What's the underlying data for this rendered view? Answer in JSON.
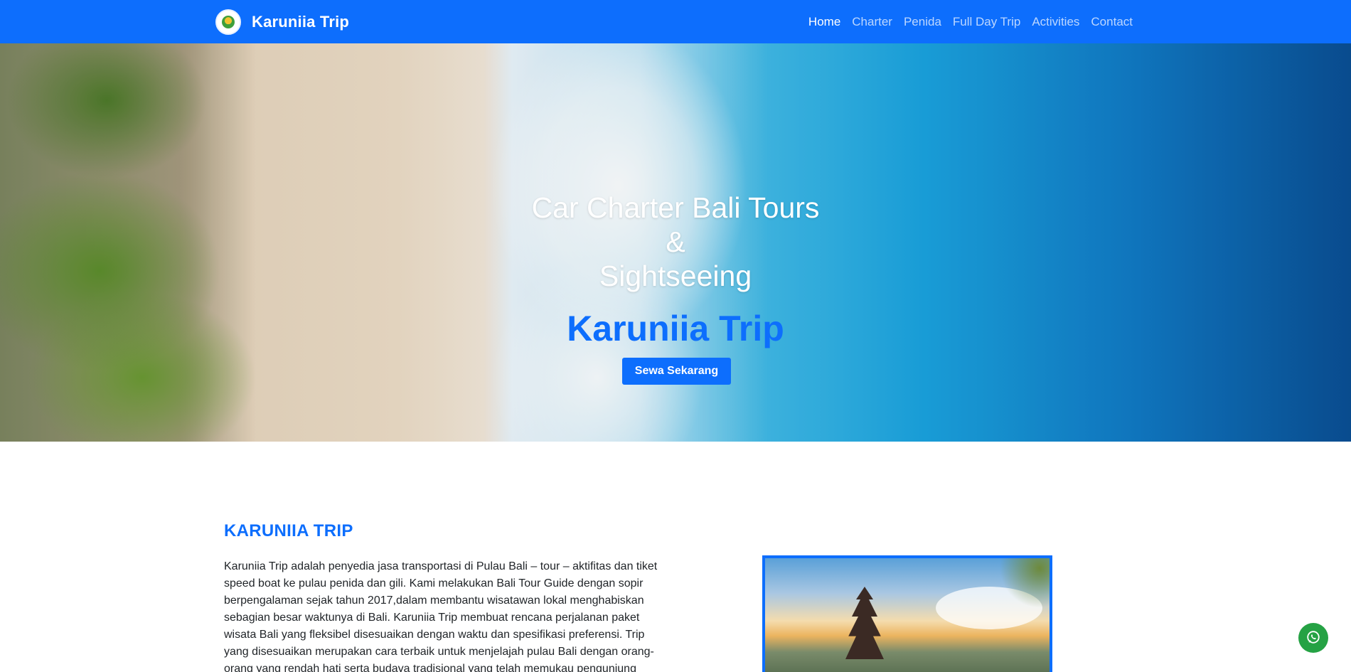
{
  "navbar": {
    "brand_name": "Karuniia Trip",
    "logo_icon": "leaf-logo-icon",
    "links": [
      {
        "label": "Home",
        "active": true
      },
      {
        "label": "Charter",
        "active": false
      },
      {
        "label": "Penida",
        "active": false
      },
      {
        "label": "Full Day Trip",
        "active": false
      },
      {
        "label": "Activities",
        "active": false
      },
      {
        "label": "Contact",
        "active": false
      }
    ]
  },
  "hero": {
    "title_line1": "Car Charter Bali Tours",
    "title_line2": "&",
    "title_line3": "Sightseeing",
    "brand": "Karuniia Trip",
    "cta_label": "Sewa Sekarang"
  },
  "about": {
    "heading": "KARUNIIA TRIP",
    "paragraph": "Karuniia Trip adalah penyedia jasa transportasi di Pulau Bali – tour – aktifitas dan tiket speed boat ke pulau penida dan gili. Kami melakukan Bali Tour Guide dengan sopir berpengalaman sejak tahun 2017,dalam membantu wisatawan lokal menghabiskan sebagian besar waktunya di Bali. Karuniia Trip membuat rencana perjalanan paket wisata Bali yang fleksibel disesuaikan dengan waktu dan spesifikasi preferensi. Trip yang disesuaikan merupakan cara terbaik untuk menjelajah pulau Bali dengan orang-orang yang rendah hati serta budaya tradisional yang telah memukau pengunjung"
  },
  "floating": {
    "whatsapp_icon": "whatsapp-icon"
  },
  "colors": {
    "primary": "#0d6efd",
    "whatsapp": "#25a244",
    "nav_text": "#ffffff"
  }
}
